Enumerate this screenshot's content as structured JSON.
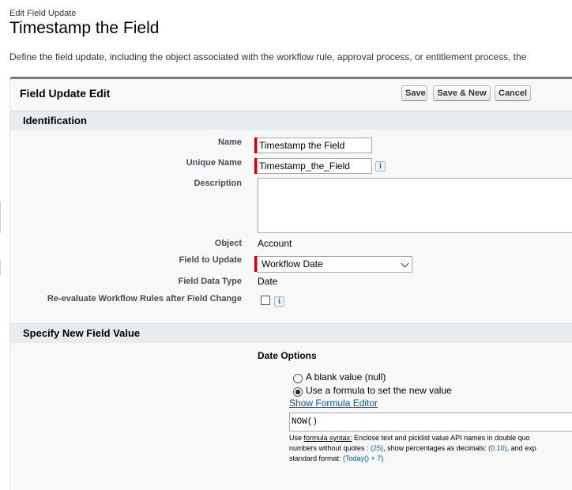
{
  "header": {
    "eyebrow": "Edit Field Update",
    "title": "Timestamp the Field",
    "description": "Define the field update, including the object associated with the workflow rule, approval process, or entitlement process, the"
  },
  "panel": {
    "title": "Field Update Edit",
    "buttons": {
      "save": "Save",
      "save_new": "Save & New",
      "cancel": "Cancel"
    }
  },
  "identification": {
    "section_title": "Identification",
    "name_label": "Name",
    "name_value": "Timestamp the Field",
    "unique_name_label": "Unique Name",
    "unique_name_value": "Timestamp_the_Field",
    "description_label": "Description",
    "description_value": "",
    "object_label": "Object",
    "object_value": "Account",
    "field_to_update_label": "Field to Update",
    "field_to_update_value": "Workflow Date",
    "field_data_type_label": "Field Data Type",
    "field_data_type_value": "Date",
    "reevaluate_label": "Re-evaluate Workflow Rules after Field Change",
    "reevaluate_checked": false,
    "info_glyph": "i"
  },
  "new_value": {
    "section_title": "Specify New Field Value",
    "date_options_label": "Date Options",
    "option_blank": "A blank value (null)",
    "option_formula": "Use a formula to set the new value",
    "selected_option": "formula",
    "show_formula_editor": "Show Formula Editor",
    "formula_value": "NOW()",
    "help": {
      "line1_prefix": "Use ",
      "line1_link": "formula syntax:",
      "line1_rest": " Enclose text and picklist value API names in double quo",
      "line2_a": "numbers without quotes : ",
      "line2_b": "(25)",
      "line2_c": ", show percentages as decimals: ",
      "line2_d": "(0.10)",
      "line2_e": ", and exp",
      "line3_a": "standard format: ",
      "line3_b": "(Today() + 7)"
    }
  },
  "colors": {
    "accent_bar": "#6f7c8c",
    "required": "#cc0000",
    "link": "#015ba7",
    "section_bg": "#e9ecef"
  }
}
